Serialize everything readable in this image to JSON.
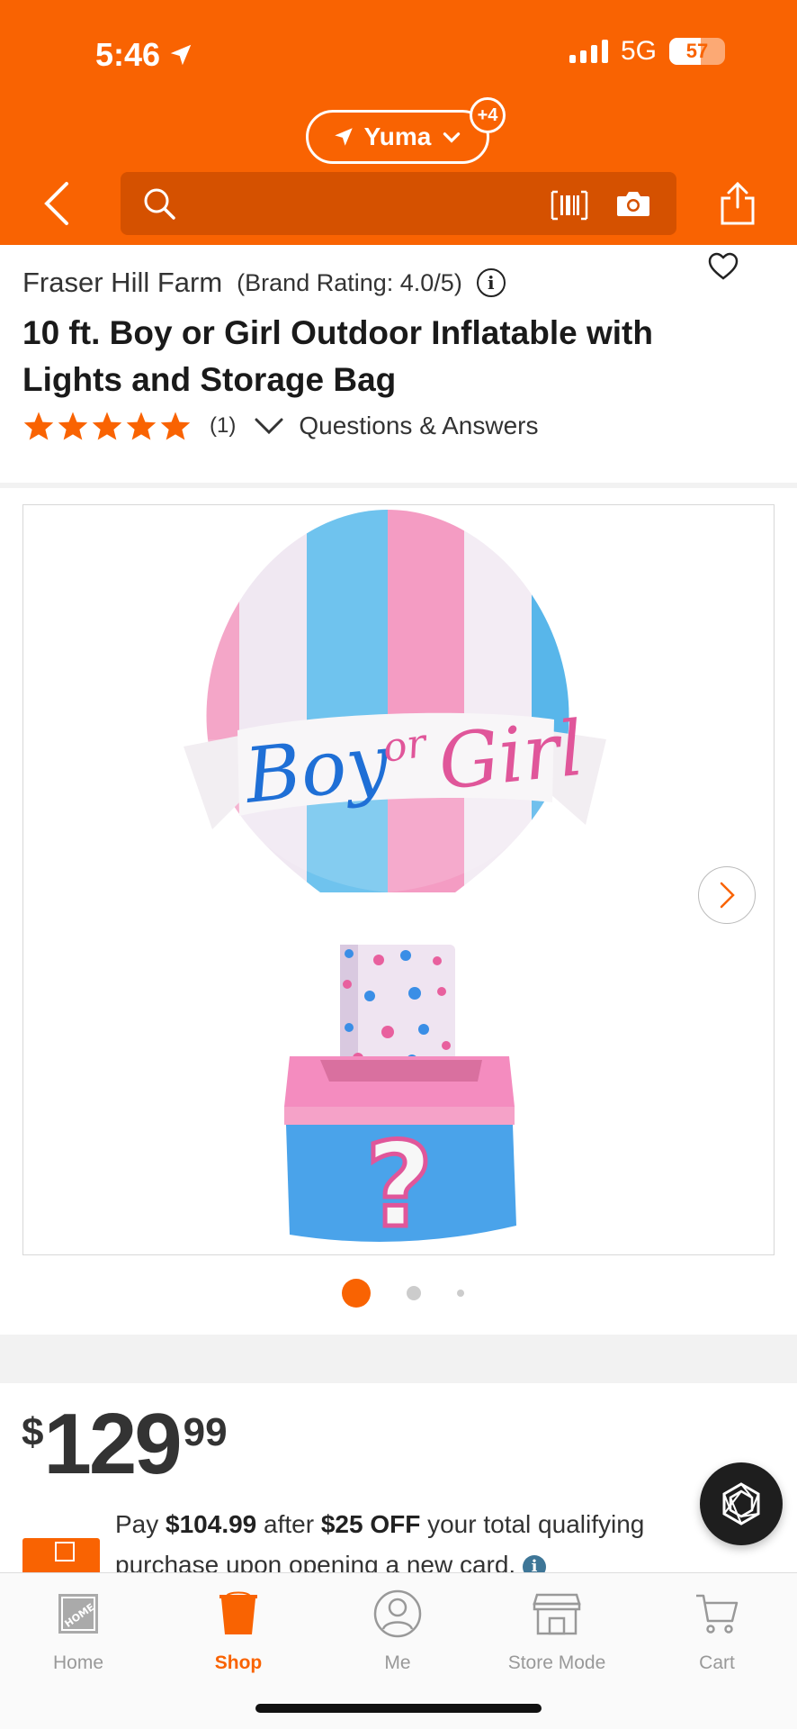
{
  "status_bar": {
    "time": "5:46",
    "network": "5G",
    "battery": "57",
    "battery_level": 0.57
  },
  "header": {
    "location": "Yuma",
    "location_badge": "+4",
    "search_placeholder": "",
    "brand_color": "#f96302"
  },
  "product": {
    "brand": "Fraser Hill Farm",
    "brand_rating": "(Brand Rating: 4.0/5)",
    "title": "10 ft. Boy or Girl Outdoor Inflatable with Lights and Storage Bag",
    "stars": 5,
    "review_count": "(1)",
    "qa_label": "Questions & Answers",
    "image_banner_text": "Boy or Girl",
    "image_question_mark": "?"
  },
  "gallery": {
    "image_count": 3,
    "active_index": 0
  },
  "price": {
    "currency": "$",
    "whole": "129",
    "cents": "99"
  },
  "card_offer": {
    "prefix": "Pay ",
    "pay_amount": "$104.99",
    "middle": " after ",
    "discount": "$25 OFF",
    "suffix": " your total qualifying purchase upon opening a new card. "
  },
  "tabbar": {
    "items": [
      {
        "label": "Home",
        "icon": "home-depot-logo-icon"
      },
      {
        "label": "Shop",
        "icon": "bucket-icon",
        "active": true
      },
      {
        "label": "Me",
        "icon": "person-icon"
      },
      {
        "label": "Store Mode",
        "icon": "store-icon"
      },
      {
        "label": "Cart",
        "icon": "cart-icon"
      }
    ]
  }
}
